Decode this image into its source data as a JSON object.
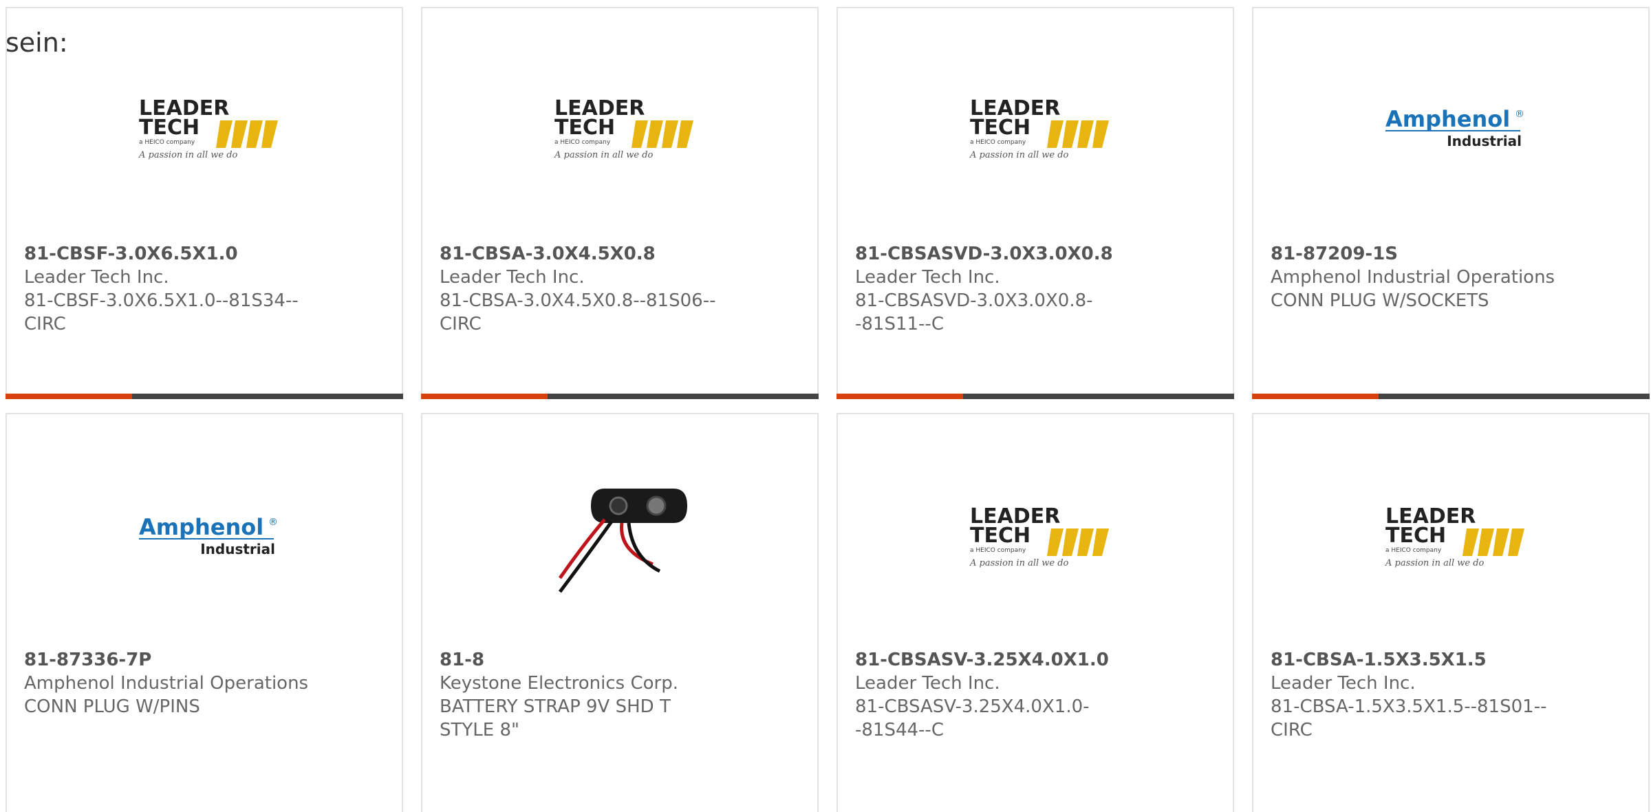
{
  "intro_text": "sein:",
  "products": [
    {
      "part_number": "81-CBSF-3.0X6.5X1.0",
      "manufacturer": "Leader Tech Inc.",
      "description": "81-CBSF-3.0X6.5X1.0--81S34--CIRC",
      "logo": "leader-tech-logo"
    },
    {
      "part_number": "81-CBSA-3.0X4.5X0.8",
      "manufacturer": "Leader Tech Inc.",
      "description": "81-CBSA-3.0X4.5X0.8--81S06--CIRC",
      "logo": "leader-tech-logo"
    },
    {
      "part_number": "81-CBSASVD-3.0X3.0X0.8",
      "manufacturer": "Leader Tech Inc.",
      "description": "81-CBSASVD-3.0X3.0X0.8--81S11--C",
      "logo": "leader-tech-logo"
    },
    {
      "part_number": "81-87209-1S",
      "manufacturer": "Amphenol Industrial Operations",
      "description": "CONN PLUG W/SOCKETS",
      "logo": "amphenol-industrial-logo"
    },
    {
      "part_number": "81-87336-7P",
      "manufacturer": "Amphenol Industrial Operations",
      "description": "CONN PLUG W/PINS",
      "logo": "amphenol-industrial-logo"
    },
    {
      "part_number": "81-8",
      "manufacturer": "Keystone Electronics Corp.",
      "description": "BATTERY STRAP 9V SHD T STYLE 8\"",
      "logo": "battery-strap-photo"
    },
    {
      "part_number": "81-CBSASV-3.25X4.0X1.0",
      "manufacturer": "Leader Tech Inc.",
      "description": "81-CBSASV-3.25X4.0X1.0--81S44--C",
      "logo": "leader-tech-logo"
    },
    {
      "part_number": "81-CBSA-1.5X3.5X1.5",
      "manufacturer": "Leader Tech Inc.",
      "description": "81-CBSA-1.5X3.5X1.5--81S01--CIRC",
      "logo": "leader-tech-logo"
    }
  ],
  "logos": {
    "leader_tech": {
      "line1": "LEADER",
      "line2": "TECH",
      "sub": "a HEICO company",
      "tagline": "A passion in all we do"
    },
    "amphenol": {
      "brand": "Amphenol",
      "reg": "®",
      "division": "Industrial"
    }
  },
  "colors": {
    "accent": "#d8400e",
    "bar": "#444444",
    "border": "#e3e3e3",
    "amphenol_blue": "#1a73b8",
    "leader_gold": "#e8b410"
  }
}
